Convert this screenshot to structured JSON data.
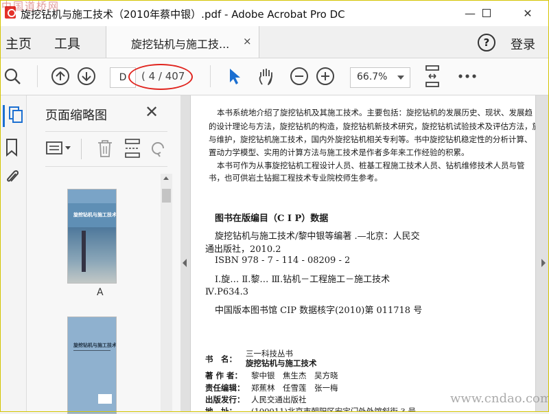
{
  "watermark_top": "中国道桥网",
  "watermark_bottom": "www.cndao.com",
  "window": {
    "title": "旋挖钻机与施工技术（2010年蔡中银）.pdf - Adobe Acrobat Pro DC",
    "min": "—",
    "max": "☐",
    "close": "✕"
  },
  "tabs": {
    "home": "主页",
    "tools": "工具",
    "doc_tab": "旋挖钻机与施工技...",
    "doc_tab_close": "×",
    "help": "?",
    "login": "登录"
  },
  "toolbar": {
    "page_input": "D",
    "page_count": "( 4 / 407",
    "zoom": "66.7%"
  },
  "panel": {
    "title": "页面缩略图",
    "close": "✕",
    "thumb1_caption": "A",
    "thumb1_title": "旋挖钻机与施工技术",
    "thumb2_title": "旋挖钻机与施工技术"
  },
  "page": {
    "p1": "本书系统地介绍了旋挖钻机及其施工技术。主要包括：旋挖钻机的发展历史、现状、发展趋",
    "p2": "的设计理论与方法，旋挖钻机的构造，旋挖钻机新技术研究，旋挖钻机试验技术及评估方法，旋",
    "p3": "与维护，旋挖钻机施工技术，国内外旋挖钻机相关专利等。书中旋挖钻机稳定性的分析计算、",
    "p4": "置动力学模型、实用的计算方法与施工技术是作者多年来工作经验的积累。",
    "p5": "本书可作为从事旋挖钻机工程设计人员、桩基工程施工技术人员、钻机维修技术人员与管",
    "p6": "书，也可供岩土钻掘工程技术专业院校师生参考。",
    "cip_title": "图书在版编目（C I P）数据",
    "cip1": "旋挖钻机与施工技术/黎中银等编著 .—北京：人民交",
    "cip2": "通出版社，2010.2",
    "cip3": "ISBN 978 - 7 - 114 - 08209 - 2",
    "cip4": "Ⅰ.旋…  Ⅱ.黎…  Ⅲ.钻机－工程施工－施工技术",
    "cip5": "Ⅳ.P634.3",
    "cip6": "中国版本图书馆 CIP 数据核字(2010)第 011718 号",
    "series": "三一科技丛书",
    "book_label": "书　名：",
    "book_name": "旋挖钻机与施工技术",
    "author_label": "著 作 者：",
    "authors": "黎中银　焦生杰　吴方晓",
    "editor_label": "责任编辑：",
    "editors": "郑蕉林　任雪莲　张一梅",
    "publisher_label": "出版发行：",
    "publisher": "人民交通出版社",
    "address_label": "地　址：",
    "address": "(100011)北京市朝阳区安定门外外馆斜街 3 号"
  }
}
